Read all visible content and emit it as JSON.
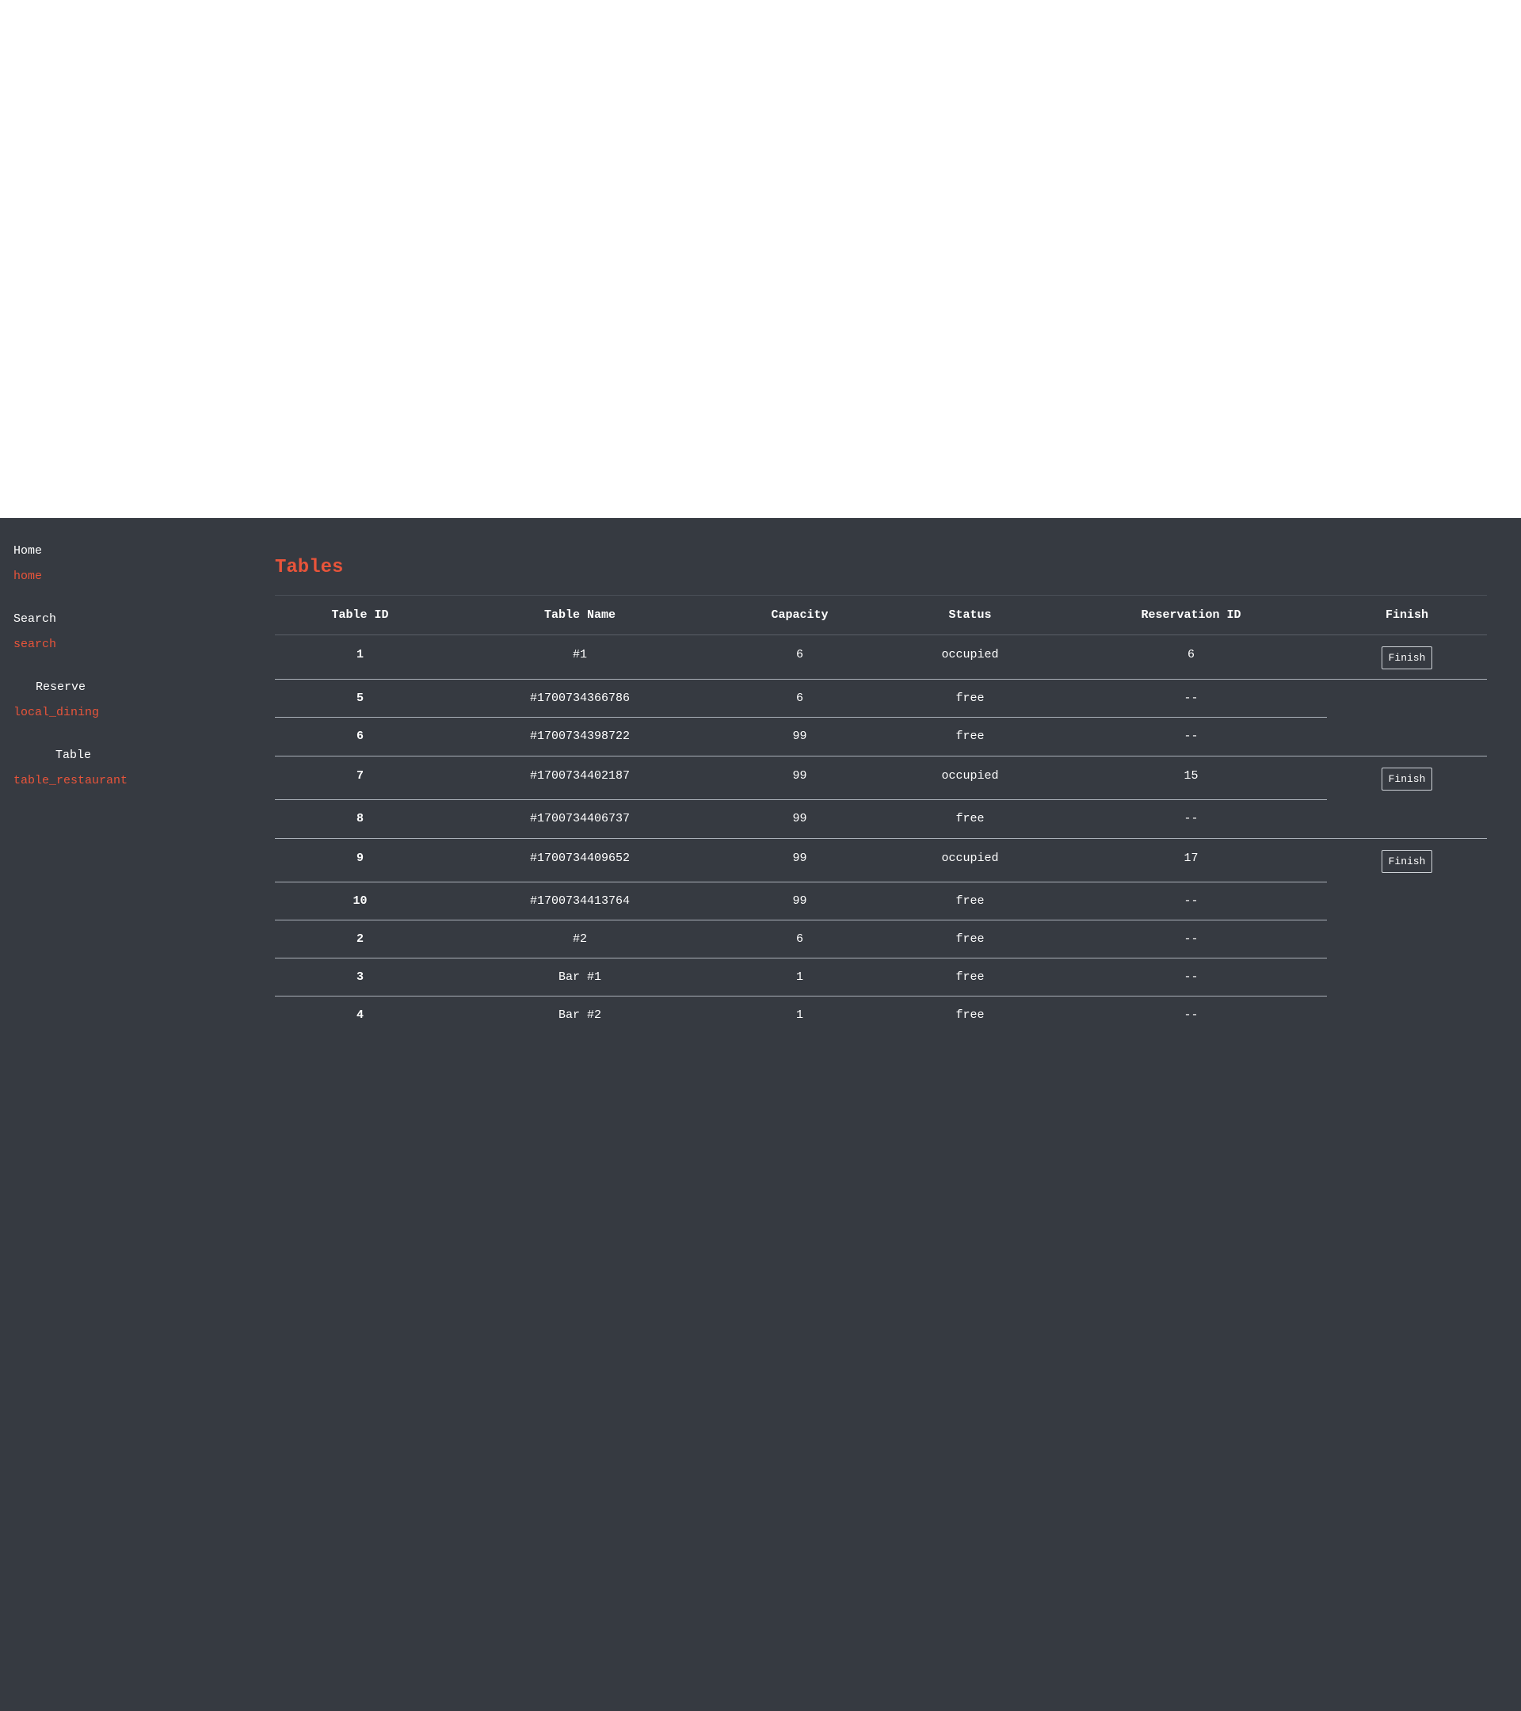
{
  "nav": [
    {
      "label": "Home",
      "icon": "home"
    },
    {
      "label": "Search",
      "icon": "search"
    },
    {
      "label": "Reserve",
      "icon": "local_dining"
    },
    {
      "label": "Table",
      "icon": "table_restaurant"
    }
  ],
  "page": {
    "title": "Tables"
  },
  "table": {
    "headers": [
      "Table ID",
      "Table Name",
      "Capacity",
      "Status",
      "Reservation ID",
      "Finish"
    ],
    "finish_label": "Finish",
    "rows": [
      {
        "id": "1",
        "name": "#1",
        "capacity": "6",
        "status": "occupied",
        "reservation": "6"
      },
      {
        "id": "5",
        "name": "#1700734366786",
        "capacity": "6",
        "status": "free",
        "reservation": "--"
      },
      {
        "id": "6",
        "name": "#1700734398722",
        "capacity": "99",
        "status": "free",
        "reservation": "--"
      },
      {
        "id": "7",
        "name": "#1700734402187",
        "capacity": "99",
        "status": "occupied",
        "reservation": "15"
      },
      {
        "id": "8",
        "name": "#1700734406737",
        "capacity": "99",
        "status": "free",
        "reservation": "--"
      },
      {
        "id": "9",
        "name": "#1700734409652",
        "capacity": "99",
        "status": "occupied",
        "reservation": "17"
      },
      {
        "id": "10",
        "name": "#1700734413764",
        "capacity": "99",
        "status": "free",
        "reservation": "--"
      },
      {
        "id": "2",
        "name": "#2",
        "capacity": "6",
        "status": "free",
        "reservation": "--"
      },
      {
        "id": "3",
        "name": "Bar #1",
        "capacity": "1",
        "status": "free",
        "reservation": "--"
      },
      {
        "id": "4",
        "name": "Bar #2",
        "capacity": "1",
        "status": "free",
        "reservation": "--"
      }
    ]
  },
  "colors": {
    "background": "#363a41",
    "accent": "#e8543a",
    "text": "#ffffff"
  }
}
